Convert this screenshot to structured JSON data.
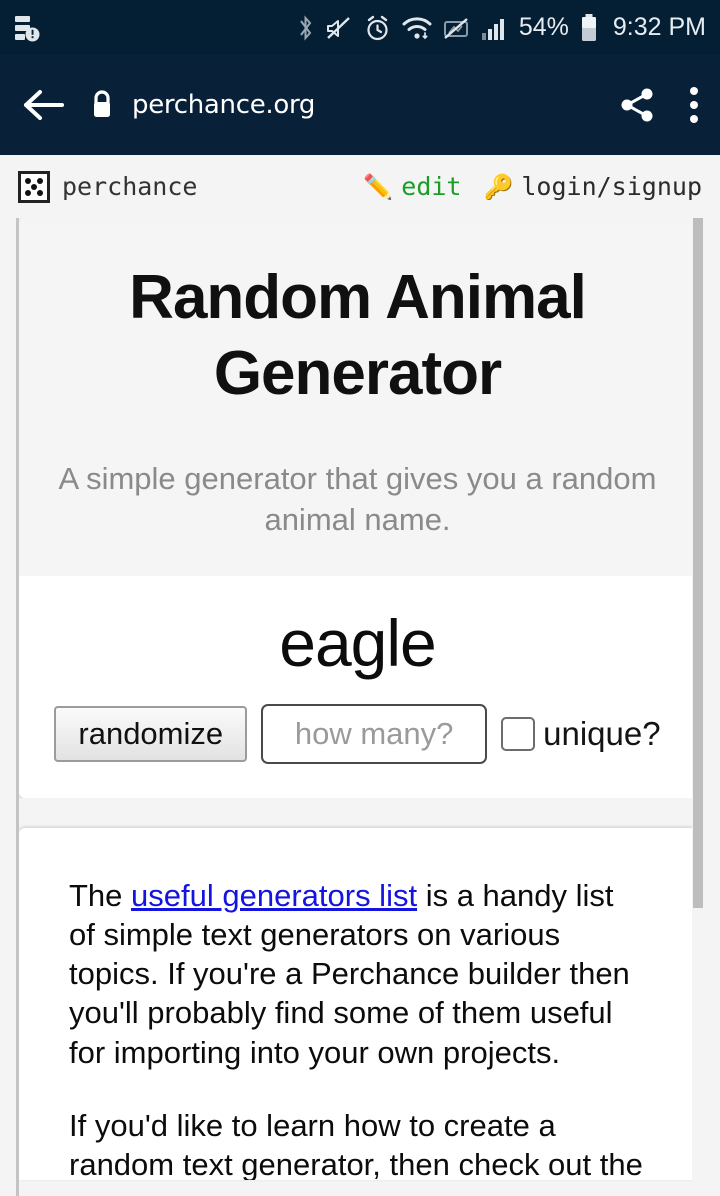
{
  "status_bar": {
    "left_icon": "storage-alert-icon",
    "icons": [
      "bluetooth-icon",
      "volume-muted-icon",
      "alarm-clock-icon",
      "wifi-icon",
      "data-saver-off-icon",
      "cellular-signal-icon"
    ],
    "battery_percent": "54%",
    "time": "9:32 PM",
    "background_color": "#041e33",
    "text_color": "#e6ecf1"
  },
  "browser": {
    "back_icon": "back-arrow-icon",
    "lock_icon": "lock-icon",
    "url": "perchance.org",
    "share_icon": "share-icon",
    "menu_icon": "overflow-menu-icon",
    "background_color": "#082038"
  },
  "site_header": {
    "logo_icon": "dice-icon",
    "brand": "perchance",
    "links": [
      {
        "icon": "pencil-icon",
        "glyph": "✏️",
        "label": "edit",
        "color": "#1a9e27"
      },
      {
        "icon": "key-icon",
        "glyph": "🔑",
        "label": "login/signup",
        "color": "#2b2b2b"
      }
    ]
  },
  "generator": {
    "title": "Random Animal Generator",
    "subtitle": "A simple generator that gives you a random animal name.",
    "output": "eagle",
    "randomize_label": "randomize",
    "how_many_placeholder": "how many?",
    "how_many_value": "",
    "unique_label": "unique?",
    "unique_checked": false
  },
  "article": {
    "paragraph1_before_link": "The ",
    "paragraph1_link": "useful generators list",
    "paragraph1_after_link": " is a handy list of simple text generators on various topics. If you're a Perchance builder then you'll probably find some of them useful for importing into your own projects.",
    "paragraph2": "If you'd like to learn how to create a random text generator, then check out the"
  },
  "scrollbar": {
    "thumb_color": "#bdbdbd",
    "track_color": "#f4f4f4"
  }
}
